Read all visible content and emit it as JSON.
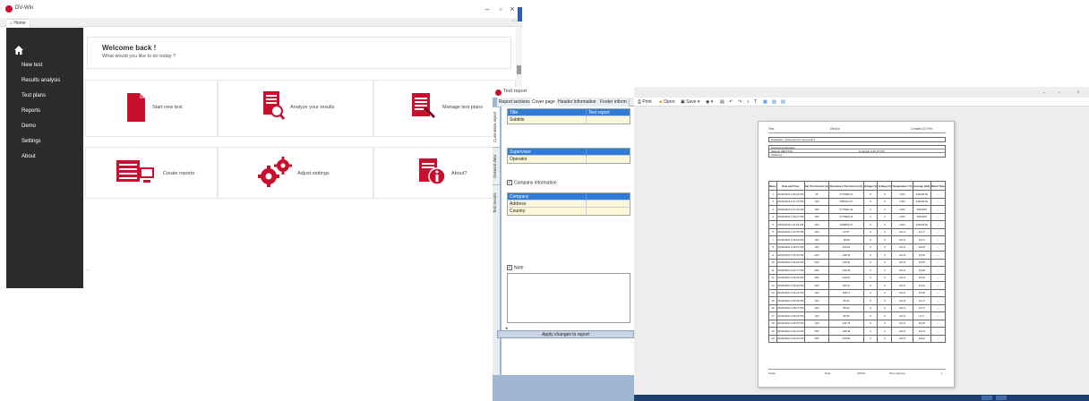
{
  "window1": {
    "title": "DV-Win",
    "tab": "Home",
    "welcome_title": "Welcome back !",
    "welcome_subtitle": "What would you like to do today ?",
    "nav": [
      "New test",
      "Results analysis",
      "Test plans",
      "Reports",
      "Demo",
      "Settings",
      "About"
    ],
    "tiles": [
      {
        "label": "Start new test",
        "icon": "document-icon"
      },
      {
        "label": "Analyze your results",
        "icon": "analyze-icon"
      },
      {
        "label": "Manage test plans",
        "icon": "test-plans-icon"
      },
      {
        "label": "Create reports",
        "icon": "reports-icon"
      },
      {
        "label": "Adjust settings",
        "icon": "gear-icon"
      },
      {
        "label": "About?",
        "icon": "info-icon"
      }
    ],
    "dots": "..."
  },
  "window2": {
    "title": "Test report",
    "tabs": [
      "Report sections",
      "Cover page",
      "Header information",
      "Footer inform"
    ],
    "vertical_tabs": [
      "Customize report",
      "General data",
      "Test results"
    ],
    "grid1": [
      [
        "Title",
        "Test report"
      ],
      [
        "Subtitle",
        ""
      ]
    ],
    "grid2": [
      [
        "Supervisor",
        ""
      ],
      [
        "Operator",
        ""
      ]
    ],
    "company_check": "Company information",
    "grid3": [
      [
        "Company",
        ""
      ],
      [
        "Address",
        ""
      ],
      [
        "Country",
        ""
      ]
    ],
    "note_check": "Note",
    "apply_button": "Apply changes to report",
    "toolbar": {
      "print": "Print",
      "open": "Open",
      "save": "Save"
    },
    "page": {
      "header_left": "Test",
      "header_mid": "Device",
      "header_right": "Created 21 Feb",
      "info_rows": [
        "Evaluation measurement test result 1",
        "General parameters",
        "Sample ABA779H",
        "Ordering ..."
      ],
      "info_right": "# sample  1/15-47 PM",
      "table_headers": [
        "Meas.",
        "Date and Time",
        "Set Test Current (A)",
        "Resistance Test Current (A)",
        "Voltage (V)",
        "Voltage (V)",
        "Temperature (°C)",
        "Average (mΩ)",
        "Rated Time"
      ],
      "rows": [
        [
          "1",
          "23/03/2016 1:06:02 PM",
          "45",
          "0779986.01",
          "0",
          "0",
          "3.6%",
          "444203.60",
          "--"
        ],
        [
          "2",
          "23/03/2016 1:07:16 PM",
          "100",
          "0585222.07",
          "0",
          "0",
          "2.5%",
          "444203.60",
          "--"
        ],
        [
          "3",
          "23/03/2016 1:07:44 PM",
          "100",
          "0779994.32",
          "0",
          "0",
          "3.6%",
          "445788.6",
          "--"
        ],
        [
          "4",
          "23/03/2016 1:08:17 PM",
          "100",
          "0779989.13",
          "0",
          "0",
          "3.6%",
          "445788.6",
          "--"
        ],
        [
          "5",
          "23/03/2016 3:11:26 PM",
          "100",
          "1188836.27",
          "0",
          "0",
          "3.6%",
          "444203.60",
          "--"
        ],
        [
          "6",
          "23/03/2016 3:14:59 PM",
          "100",
          "20.97",
          "0",
          "0",
          "101.9",
          "10.17",
          "--"
        ],
        [
          "7",
          "23/03/2016 3:16:03 PM",
          "100",
          "38.98",
          "0",
          "0",
          "101.9",
          "10.17",
          "--"
        ],
        [
          "8",
          "23/03/2016 3:16:51 PM",
          "100",
          "166.81",
          "0",
          "0",
          "101.9",
          "18.28",
          "--"
        ],
        [
          "9",
          "23/03/2016 3:18:19 PM",
          "200",
          "168.04",
          "0",
          "0",
          "101.8",
          "23.29",
          "--"
        ],
        [
          "10",
          "23/03/2016 3:18:29 PM",
          "200",
          "239.60",
          "0",
          "0",
          "101.8",
          "23.52",
          "--"
        ],
        [
          "11",
          "23/03/2016 3:22:17 PM",
          "200",
          "239.23",
          "0",
          "0",
          "101.9",
          "23.28",
          "--"
        ],
        [
          "12",
          "23/03/2016 3:26:09 PM",
          "200",
          "249.61",
          "0",
          "0",
          "101.9",
          "23.49",
          "--"
        ],
        [
          "13",
          "23/03/2016 3:26:30 PM",
          "200",
          "190.67",
          "0",
          "0",
          "101.8",
          "23.33",
          "--"
        ],
        [
          "14",
          "23/03/2016 3:26:41 PM",
          "100",
          "198.17",
          "0",
          "0",
          "101.8",
          "15.28",
          "--"
        ],
        [
          "15",
          "23/03/2016 3:26:53 PM",
          "100",
          "85.41",
          "0",
          "0",
          "101.8",
          "10.17",
          "--"
        ],
        [
          "16",
          "23/03/2016 3:28:27 PM",
          "100",
          "86.03",
          "0",
          "0",
          "101.9",
          "10.17",
          "--"
        ],
        [
          "17",
          "23/03/2016 3:28:39 PM",
          "100",
          "86.05",
          "0",
          "0",
          "101.9",
          "9.17",
          "--"
        ],
        [
          "18",
          "23/03/2016 3:28:50 PM",
          "100",
          "146.79",
          "0",
          "0",
          "101.9",
          "15.28",
          "--"
        ],
        [
          "19",
          "23/03/2016 3:29:13 PM",
          "200",
          "198.46",
          "0",
          "0",
          "101.8",
          "23.33",
          "--"
        ],
        [
          "20",
          "23/03/2016 3:29:32 PM",
          "200",
          "239.60",
          "0",
          "0",
          "101.8",
          "23.52",
          "--"
        ]
      ],
      "footer_left": "Tester",
      "footer_date_label": "Date",
      "footer_date": "3/2022",
      "footer_mid": "Test engineer",
      "footer_page": "1"
    }
  },
  "colors": {
    "accent_red": "#c8102e",
    "sidebar": "#2b2b2b",
    "grid_header_blue": "#2f7bd6",
    "pane_blue": "#9fb6d2"
  }
}
